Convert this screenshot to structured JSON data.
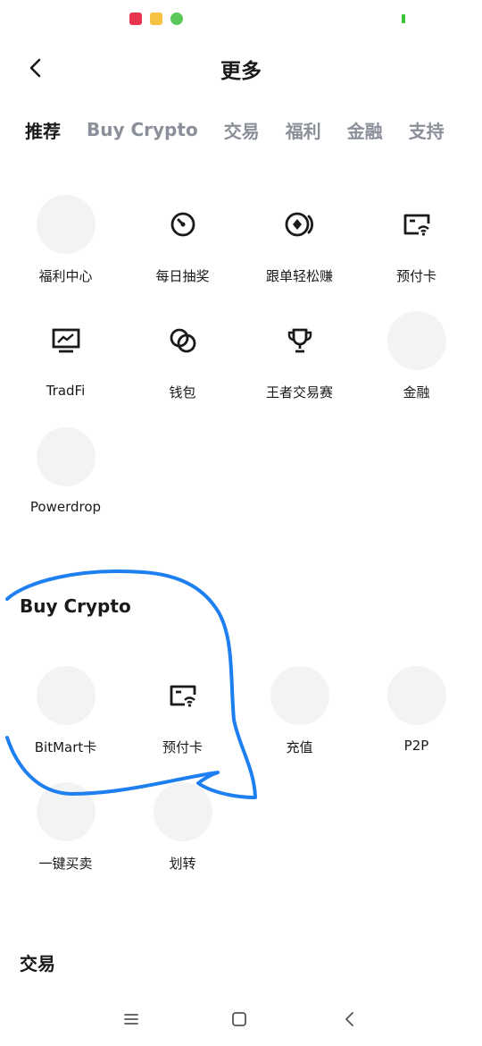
{
  "header": {
    "title": "更多"
  },
  "tabs": [
    {
      "label": "推荐",
      "active": true
    },
    {
      "label": "Buy Crypto",
      "active": false
    },
    {
      "label": "交易",
      "active": false
    },
    {
      "label": "福利",
      "active": false
    },
    {
      "label": "金融",
      "active": false
    },
    {
      "label": "支持",
      "active": false
    }
  ],
  "recommended": {
    "items": [
      {
        "label": "福利中心",
        "icon": "placeholder-circle"
      },
      {
        "label": "每日抽奖",
        "icon": "lottery-dial-icon"
      },
      {
        "label": "跟单轻松赚",
        "icon": "copy-trade-coin-icon"
      },
      {
        "label": "预付卡",
        "icon": "prepaid-card-icon"
      },
      {
        "label": "TradFi",
        "icon": "chart-monitor-icon"
      },
      {
        "label": "钱包",
        "icon": "wallet-coins-icon"
      },
      {
        "label": "王者交易赛",
        "icon": "trophy-icon"
      },
      {
        "label": "金融",
        "icon": "placeholder-circle"
      },
      {
        "label": "Powerdrop",
        "icon": "placeholder-circle"
      }
    ]
  },
  "buy_crypto": {
    "title": "Buy Crypto",
    "items": [
      {
        "label": "BitMart卡",
        "icon": "placeholder-circle"
      },
      {
        "label": "预付卡",
        "icon": "prepaid-card-icon"
      },
      {
        "label": "充值",
        "icon": "placeholder-circle"
      },
      {
        "label": "P2P",
        "icon": "placeholder-circle"
      },
      {
        "label": "一键买卖",
        "icon": "placeholder-circle"
      },
      {
        "label": "划转",
        "icon": "placeholder-circle"
      }
    ]
  },
  "trade": {
    "title": "交易"
  },
  "colors": {
    "annotation": "#1e7ff0",
    "placeholder": "#f2f3f5",
    "tab_inactive": "#8a8f99"
  }
}
